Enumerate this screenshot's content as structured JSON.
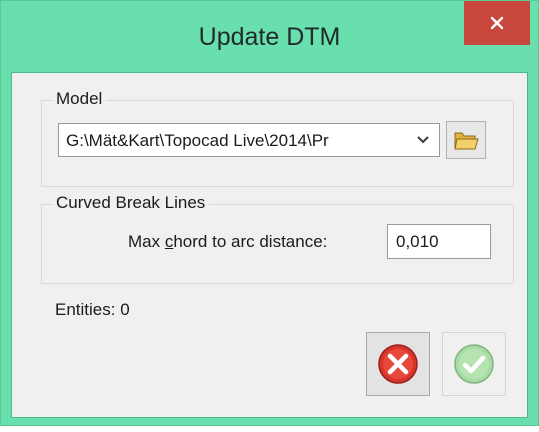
{
  "window": {
    "title": "Update DTM",
    "close_icon": "close-icon"
  },
  "model": {
    "legend": "Model",
    "path_value": "G:\\Mät&Kart\\Topocad Live\\2014\\Pr",
    "dropdown_icon": "chevron-down-icon",
    "browse_icon": "folder-icon"
  },
  "curved_break_lines": {
    "legend": "Curved Break Lines",
    "chord_label_prefix": "Max ",
    "chord_label_mnemonic": "c",
    "chord_label_suffix": "hord to arc distance:",
    "chord_value": "0,010"
  },
  "status": {
    "entities_text": "Entities: 0"
  },
  "actions": {
    "cancel_icon": "cancel-x-icon",
    "ok_icon": "ok-check-icon",
    "ok_enabled": false
  },
  "colors": {
    "frame": "#68dfad",
    "close": "#c8463c",
    "cancel_red": "#d9342b",
    "ok_green": "#6fcf6a"
  }
}
